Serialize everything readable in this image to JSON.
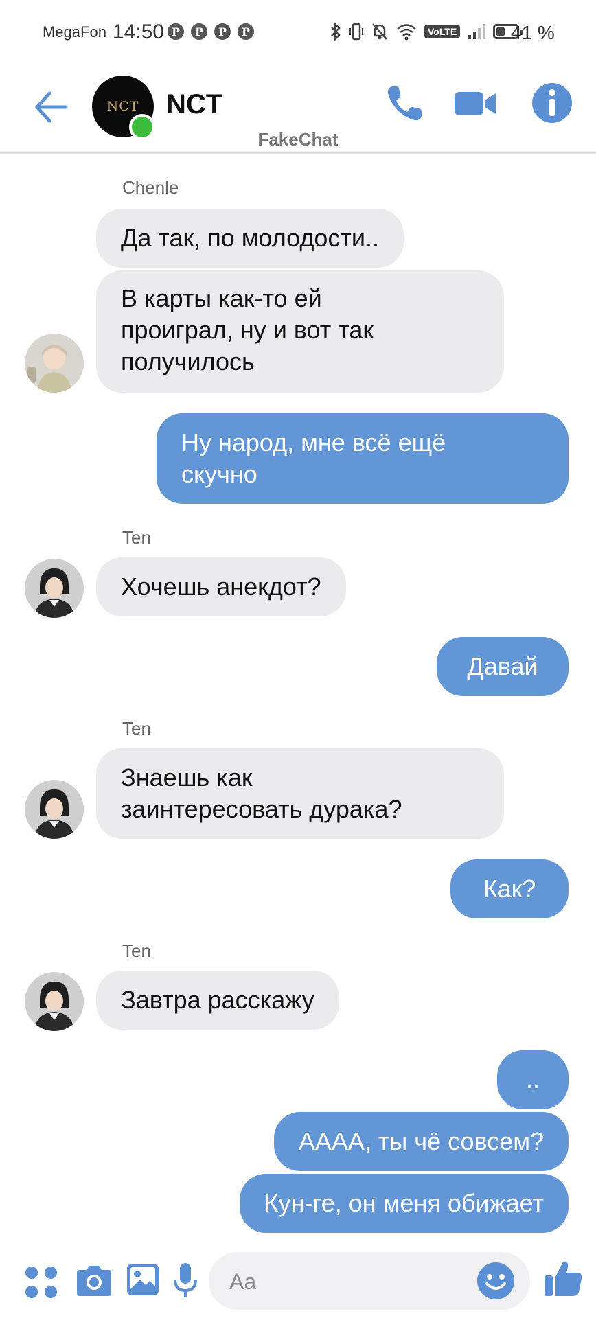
{
  "status_bar": {
    "carrier": "MegaFon",
    "time": "14:50",
    "notification_icons": [
      "pinterest-icon",
      "pinterest-icon",
      "pinterest-icon",
      "pinterest-icon"
    ],
    "volte": "VoLTE",
    "battery_percent_text": "41 %",
    "battery_level": 0.41
  },
  "header": {
    "avatar_text": "NCT",
    "title": "NCT",
    "watermark": "FakeChat",
    "accent_color": "#5b8fd3",
    "online_color": "#3dbb3d"
  },
  "messages": [
    {
      "id": "m1",
      "direction": "incoming",
      "sender": "Chenle",
      "text": "Да так, по молодости.."
    },
    {
      "id": "m2",
      "direction": "incoming",
      "lines": [
        "В карты как-то ей",
        "проиграл, ну и вот так",
        "получилось"
      ]
    },
    {
      "id": "m3",
      "direction": "outgoing",
      "lines": [
        "Ну народ, мне всё ещё",
        "скучно"
      ]
    },
    {
      "id": "m4",
      "direction": "incoming",
      "sender": "Ten",
      "text": "Хочешь анекдот?"
    },
    {
      "id": "m5",
      "direction": "outgoing",
      "text": "Давай"
    },
    {
      "id": "m6",
      "direction": "incoming",
      "sender": "Ten",
      "lines": [
        "Знаешь как",
        "заинтересовать дурака?"
      ]
    },
    {
      "id": "m7",
      "direction": "outgoing",
      "text": "Как?"
    },
    {
      "id": "m8",
      "direction": "incoming",
      "sender": "Ten",
      "text": "Завтра расскажу"
    },
    {
      "id": "m9",
      "direction": "outgoing",
      "text": ".."
    },
    {
      "id": "m10",
      "direction": "outgoing",
      "text": "АААА, ты чё совсем?"
    },
    {
      "id": "m11",
      "direction": "outgoing",
      "text": "Кун-ге, он меня обижает"
    }
  ],
  "composer": {
    "placeholder": "Aa"
  }
}
